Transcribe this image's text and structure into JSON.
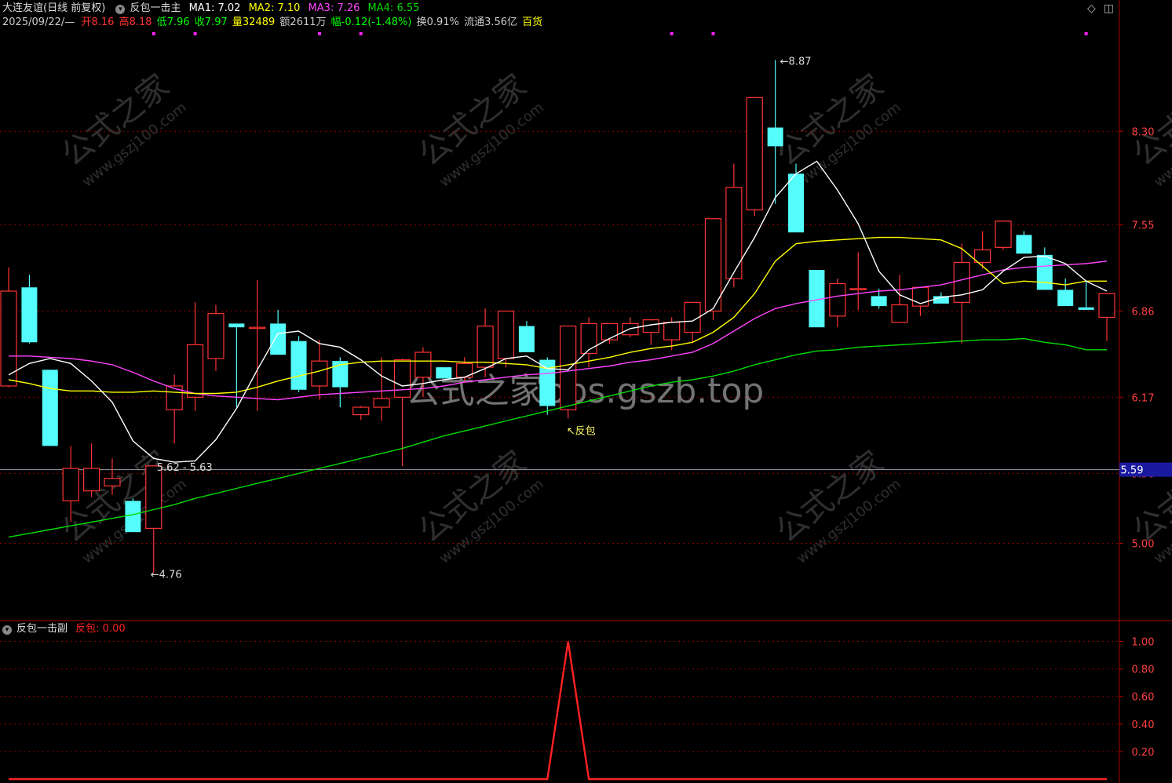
{
  "header": {
    "stock_name": "大连友谊",
    "period": "(日线 前复权)",
    "main_indicator": "反包一击主",
    "ma": [
      {
        "label": "MA1: 7.02",
        "color": "#ffffff"
      },
      {
        "label": "MA2: 7.10",
        "color": "#ffff00"
      },
      {
        "label": "MA3: 7.26",
        "color": "#ff44ff"
      },
      {
        "label": "MA4: 6.55",
        "color": "#00dd00"
      }
    ],
    "date": "2025/09/22/—",
    "open_label": "开",
    "open": "8.16",
    "high_label": "高",
    "high": "8.18",
    "low_label": "低",
    "low": "7.96",
    "close_label": "收",
    "close": "7.97",
    "volume_label": "量",
    "volume": "32489",
    "amount_label": "额",
    "amount": "2611万",
    "change_label": "幅",
    "change": "-0.12(-1.48%)",
    "turnover_label": "换",
    "turnover": "0.91%",
    "float_label": "流通",
    "float": "3.56亿",
    "sector": "百货"
  },
  "sub_header": {
    "indicator": "反包一击副",
    "value_label": "反包: 0.00"
  },
  "watermark": {
    "center": "公式之家bbs.gszb.top",
    "tile_cn": "公式之家",
    "tile_url": "www.gszj100.com"
  },
  "colors": {
    "up": "#ff3333",
    "down": "#54fcfc",
    "grid": "#8b0000",
    "ma1": "#ffffff",
    "ma2": "#ffff00",
    "ma3": "#ff44ff",
    "ma4": "#00dd00",
    "signal": "#ff2222",
    "price_tag": "#1a1aa0"
  },
  "chart_data": [
    {
      "type": "candlestick",
      "title": "反包一击主",
      "ylim": [
        4.4,
        9.1
      ],
      "y_ticks": [
        "8.30",
        "7.55",
        "6.86",
        "6.17",
        "5.56",
        "5.00"
      ],
      "y_tick_values": [
        8.3,
        7.55,
        6.86,
        6.17,
        5.56,
        5.0
      ],
      "current_price_label": "5.59",
      "current_price": 5.59,
      "candles": [
        {
          "o": 6.26,
          "h": 7.21,
          "l": 6.25,
          "c": 7.02
        },
        {
          "o": 7.05,
          "h": 7.15,
          "l": 6.6,
          "c": 6.61
        },
        {
          "o": 6.39,
          "h": 6.39,
          "l": 5.78,
          "c": 5.78
        },
        {
          "o": 5.34,
          "h": 5.78,
          "l": 5.17,
          "c": 5.6
        },
        {
          "o": 5.42,
          "h": 5.8,
          "l": 5.37,
          "c": 5.6
        },
        {
          "o": 5.46,
          "h": 5.68,
          "l": 5.39,
          "c": 5.52
        },
        {
          "o": 5.34,
          "h": 5.36,
          "l": 5.09,
          "c": 5.09
        },
        {
          "o": 5.12,
          "h": 5.62,
          "l": 4.76,
          "c": 5.62
        },
        {
          "o": 6.07,
          "h": 6.35,
          "l": 5.8,
          "c": 6.26
        },
        {
          "o": 6.17,
          "h": 6.93,
          "l": 6.06,
          "c": 6.59
        },
        {
          "o": 6.48,
          "h": 6.91,
          "l": 6.38,
          "c": 6.84
        },
        {
          "o": 6.76,
          "h": 6.73,
          "l": 6.09,
          "c": 6.73
        },
        {
          "o": 6.73,
          "h": 7.11,
          "l": 6.06,
          "c": 6.73
        },
        {
          "o": 6.76,
          "h": 6.87,
          "l": 6.51,
          "c": 6.51
        },
        {
          "o": 6.62,
          "h": 6.66,
          "l": 6.21,
          "c": 6.23
        },
        {
          "o": 6.26,
          "h": 6.63,
          "l": 6.15,
          "c": 6.46
        },
        {
          "o": 6.46,
          "h": 6.49,
          "l": 6.09,
          "c": 6.25
        },
        {
          "o": 6.03,
          "h": 6.1,
          "l": 5.99,
          "c": 6.09
        },
        {
          "o": 6.09,
          "h": 6.49,
          "l": 5.98,
          "c": 6.16
        },
        {
          "o": 6.17,
          "h": 6.48,
          "l": 5.62,
          "c": 6.47
        },
        {
          "o": 6.33,
          "h": 6.57,
          "l": 6.17,
          "c": 6.53
        },
        {
          "o": 6.41,
          "h": 6.41,
          "l": 6.35,
          "c": 6.32
        },
        {
          "o": 6.33,
          "h": 6.49,
          "l": 6.29,
          "c": 6.44
        },
        {
          "o": 6.41,
          "h": 6.88,
          "l": 6.33,
          "c": 6.74
        },
        {
          "o": 6.48,
          "h": 6.86,
          "l": 6.41,
          "c": 6.86
        },
        {
          "o": 6.74,
          "h": 6.78,
          "l": 6.53,
          "c": 6.53
        },
        {
          "o": 6.47,
          "h": 6.49,
          "l": 6.03,
          "c": 6.1
        },
        {
          "o": 6.07,
          "h": 6.74,
          "l": 6.0,
          "c": 6.74
        },
        {
          "o": 6.52,
          "h": 6.81,
          "l": 6.41,
          "c": 6.76
        },
        {
          "o": 6.63,
          "h": 6.76,
          "l": 6.6,
          "c": 6.76
        },
        {
          "o": 6.67,
          "h": 6.81,
          "l": 6.65,
          "c": 6.76
        },
        {
          "o": 6.69,
          "h": 6.79,
          "l": 6.59,
          "c": 6.79
        },
        {
          "o": 6.63,
          "h": 6.81,
          "l": 6.55,
          "c": 6.77
        },
        {
          "o": 6.69,
          "h": 6.93,
          "l": 6.61,
          "c": 6.93
        },
        {
          "o": 6.86,
          "h": 7.6,
          "l": 6.79,
          "c": 7.6
        },
        {
          "o": 7.12,
          "h": 8.04,
          "l": 7.05,
          "c": 7.85
        },
        {
          "o": 7.67,
          "h": 8.57,
          "l": 7.62,
          "c": 8.57
        },
        {
          "o": 8.33,
          "h": 8.87,
          "l": 7.72,
          "c": 8.18
        },
        {
          "o": 7.96,
          "h": 8.04,
          "l": 7.49,
          "c": 7.49
        },
        {
          "o": 7.19,
          "h": 7.19,
          "l": 6.73,
          "c": 6.73
        },
        {
          "o": 6.82,
          "h": 7.12,
          "l": 6.73,
          "c": 7.08
        },
        {
          "o": 7.04,
          "h": 7.33,
          "l": 6.87,
          "c": 7.04
        },
        {
          "o": 6.98,
          "h": 7.04,
          "l": 6.88,
          "c": 6.9
        },
        {
          "o": 6.77,
          "h": 7.15,
          "l": 6.77,
          "c": 6.91
        },
        {
          "o": 6.9,
          "h": 7.05,
          "l": 6.82,
          "c": 7.05
        },
        {
          "o": 6.98,
          "h": 7.01,
          "l": 6.92,
          "c": 6.92
        },
        {
          "o": 6.93,
          "h": 7.4,
          "l": 6.6,
          "c": 7.25
        },
        {
          "o": 7.25,
          "h": 7.5,
          "l": 7.2,
          "c": 7.35
        },
        {
          "o": 7.37,
          "h": 7.58,
          "l": 7.35,
          "c": 7.58
        },
        {
          "o": 7.47,
          "h": 7.5,
          "l": 7.32,
          "c": 7.32
        },
        {
          "o": 7.31,
          "h": 7.37,
          "l": 7.03,
          "c": 7.03
        },
        {
          "o": 7.03,
          "h": 7.12,
          "l": 6.9,
          "c": 6.9
        },
        {
          "o": 6.89,
          "h": 7.1,
          "l": 6.87,
          "c": 6.87
        },
        {
          "o": 6.81,
          "h": 7.0,
          "l": 6.62,
          "c": 7.0
        }
      ],
      "ma1": [
        6.35,
        6.44,
        6.48,
        6.44,
        6.3,
        6.13,
        5.82,
        5.68,
        5.65,
        5.66,
        5.83,
        6.08,
        6.39,
        6.68,
        6.7,
        6.6,
        6.57,
        6.47,
        6.34,
        6.26,
        6.28,
        6.31,
        6.33,
        6.4,
        6.48,
        6.5,
        6.4,
        6.39,
        6.55,
        6.64,
        6.72,
        6.75,
        6.77,
        6.78,
        6.88,
        7.17,
        7.45,
        7.77,
        7.96,
        8.06,
        7.83,
        7.56,
        7.18,
        6.99,
        6.92,
        6.97,
        6.99,
        7.03,
        7.18,
        7.29,
        7.3,
        7.24,
        7.1,
        7.02
      ],
      "ma2": [
        6.31,
        6.28,
        6.24,
        6.22,
        6.22,
        6.21,
        6.21,
        6.22,
        6.21,
        6.2,
        6.2,
        6.21,
        6.25,
        6.3,
        6.34,
        6.38,
        6.43,
        6.45,
        6.46,
        6.46,
        6.46,
        6.46,
        6.45,
        6.45,
        6.44,
        6.43,
        6.4,
        6.43,
        6.46,
        6.49,
        6.53,
        6.56,
        6.58,
        6.61,
        6.69,
        6.81,
        7.0,
        7.26,
        7.4,
        7.42,
        7.43,
        7.44,
        7.45,
        7.45,
        7.44,
        7.43,
        7.36,
        7.22,
        7.08,
        7.1,
        7.09,
        7.07,
        7.1,
        7.1
      ],
      "ma3": [
        6.5,
        6.5,
        6.49,
        6.48,
        6.46,
        6.43,
        6.37,
        6.3,
        6.24,
        6.2,
        6.18,
        6.17,
        6.16,
        6.15,
        6.17,
        6.19,
        6.2,
        6.21,
        6.22,
        6.23,
        6.24,
        6.26,
        6.29,
        6.31,
        6.33,
        6.35,
        6.36,
        6.38,
        6.4,
        6.42,
        6.45,
        6.47,
        6.5,
        6.53,
        6.6,
        6.7,
        6.8,
        6.88,
        6.92,
        6.95,
        6.98,
        7.0,
        7.02,
        7.03,
        7.05,
        7.07,
        7.11,
        7.15,
        7.19,
        7.21,
        7.22,
        7.23,
        7.24,
        7.26
      ],
      "ma4": [
        5.05,
        5.08,
        5.11,
        5.14,
        5.17,
        5.2,
        5.23,
        5.27,
        5.31,
        5.36,
        5.4,
        5.44,
        5.48,
        5.52,
        5.56,
        5.6,
        5.64,
        5.68,
        5.72,
        5.76,
        5.81,
        5.86,
        5.9,
        5.94,
        5.98,
        6.02,
        6.06,
        6.1,
        6.14,
        6.18,
        6.22,
        6.26,
        6.29,
        6.31,
        6.34,
        6.38,
        6.43,
        6.47,
        6.51,
        6.54,
        6.55,
        6.57,
        6.58,
        6.59,
        6.6,
        6.61,
        6.62,
        6.63,
        6.63,
        6.64,
        6.61,
        6.59,
        6.55,
        6.55
      ],
      "annotations": [
        {
          "text": "8.87",
          "index": 37,
          "value": 8.87
        },
        {
          "text": "4.76",
          "index": 7,
          "value": 4.76
        },
        {
          "text": "5.62 - 5.63",
          "index": 7,
          "value": 5.63
        },
        {
          "text": "反包",
          "index": 27,
          "value": 6.0
        }
      ],
      "markers": [
        7,
        9,
        15,
        17,
        32,
        34,
        52
      ]
    },
    {
      "type": "line",
      "title": "反包一击副",
      "ylim": [
        0,
        1.1
      ],
      "y_ticks": [
        "1.00",
        "0.80",
        "0.60",
        "0.40",
        "0.20"
      ],
      "y_tick_values": [
        1.0,
        0.8,
        0.6,
        0.4,
        0.2
      ],
      "series": [
        {
          "name": "反包",
          "values": [
            0,
            0,
            0,
            0,
            0,
            0,
            0,
            0,
            0,
            0,
            0,
            0,
            0,
            0,
            0,
            0,
            0,
            0,
            0,
            0,
            0,
            0,
            0,
            0,
            0,
            0,
            0,
            1,
            0,
            0,
            0,
            0,
            0,
            0,
            0,
            0,
            0,
            0,
            0,
            0,
            0,
            0,
            0,
            0,
            0,
            0,
            0,
            0,
            0,
            0,
            0,
            0,
            0,
            0
          ]
        }
      ]
    }
  ]
}
